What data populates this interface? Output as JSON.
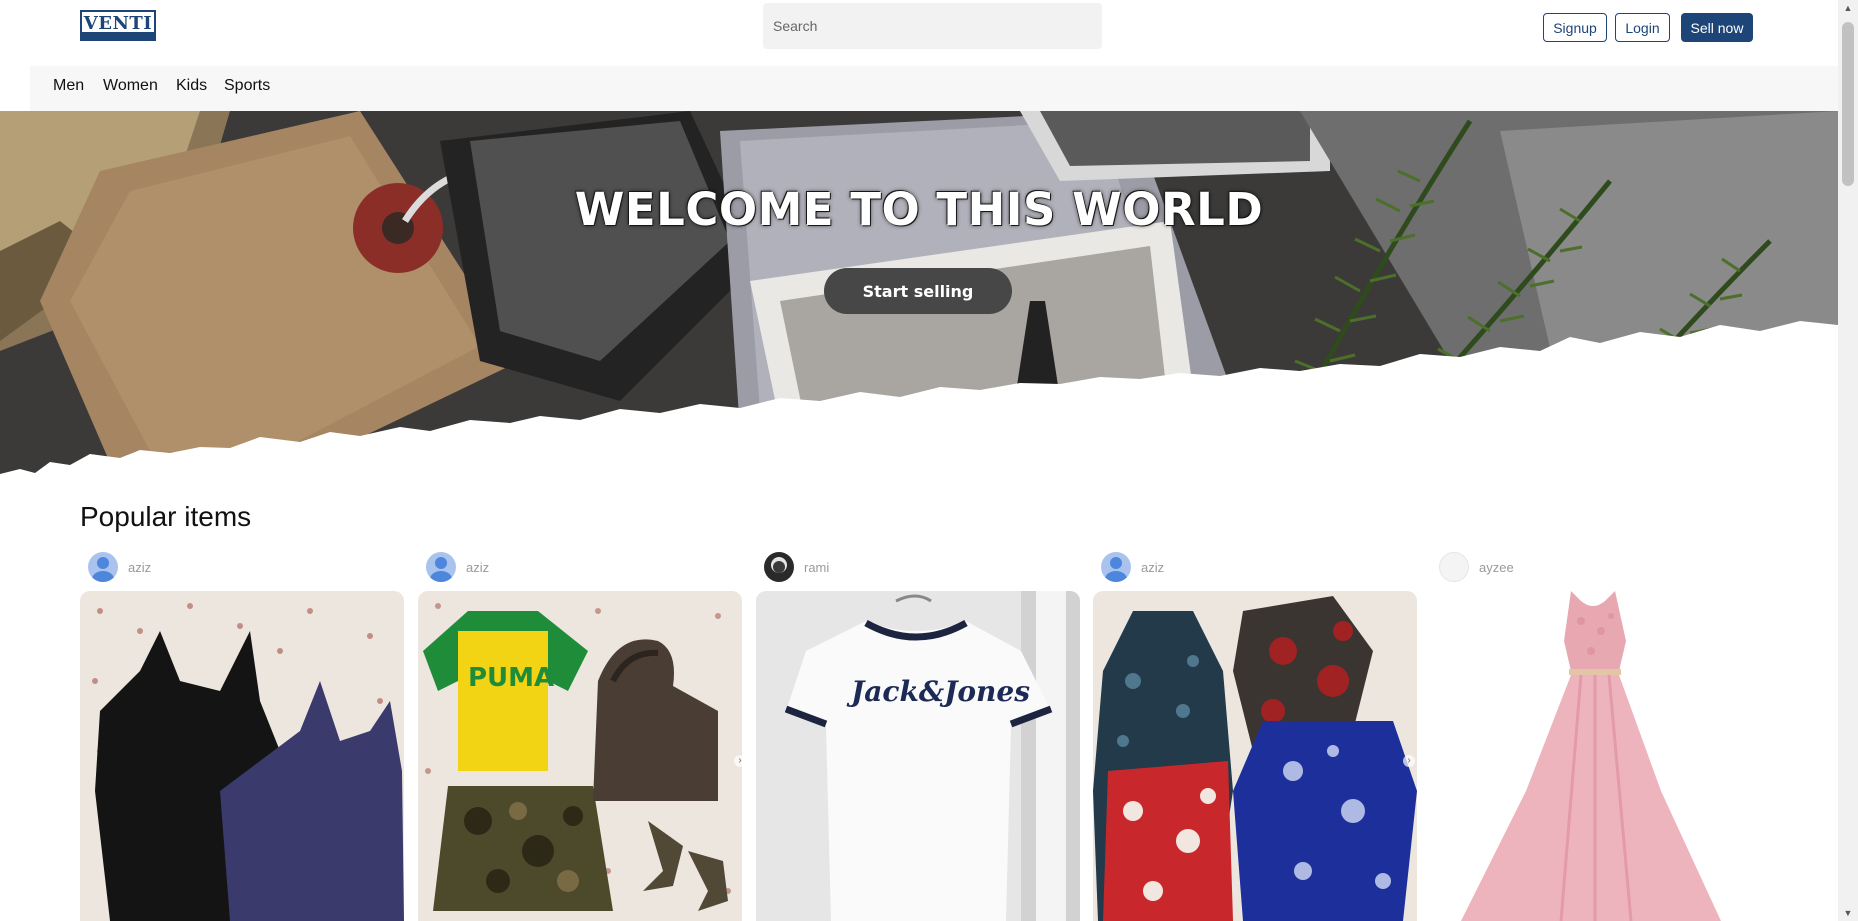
{
  "header": {
    "logo_text": "VENTI",
    "search_placeholder": "Search",
    "signup_label": "Signup",
    "login_label": "Login",
    "sell_label": "Sell now"
  },
  "nav": {
    "items": [
      "Men",
      "Women",
      "Kids",
      "Sports"
    ]
  },
  "hero": {
    "title": "WELCOME TO THIS WORLD",
    "button_label": "Start selling"
  },
  "popular": {
    "title": "Popular items",
    "items": [
      {
        "seller": "aziz",
        "avatar": "default-user-icon",
        "product": "slip-dresses"
      },
      {
        "seller": "aziz",
        "avatar": "default-user-icon",
        "product": "puma-outfit"
      },
      {
        "seller": "rami",
        "avatar": "user-photo",
        "product": "jack-jones-tshirt"
      },
      {
        "seller": "aziz",
        "avatar": "default-user-icon",
        "product": "floral-dresses"
      },
      {
        "seller": "ayzee",
        "avatar": "blank-avatar",
        "product": "pink-gown"
      }
    ]
  },
  "colors": {
    "brand": "#1e4577",
    "nav_bg": "#f7f7f8",
    "search_bg": "#f2f2f3",
    "hero_button": "#474747"
  }
}
